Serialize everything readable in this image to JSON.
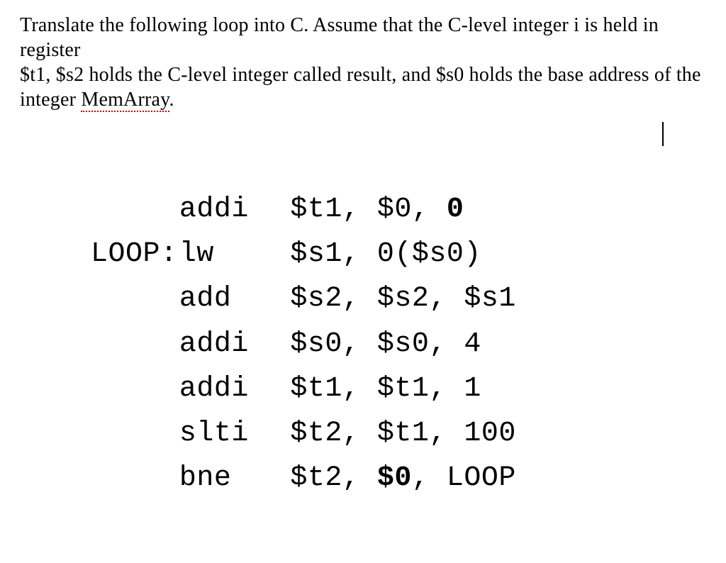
{
  "question": {
    "line1_a": "Translate the following loop into C. Assume that the C-level integer i is held in register",
    "line2_a": "$t1, $s2 holds the C-level integer called result, and $s0 holds the base address of the",
    "line3_a": "integer ",
    "memarray": "MemArray",
    "line3_b": "."
  },
  "code": {
    "l1_label": "",
    "l1_op": "addi",
    "l1_args_a": " $t1, $0, ",
    "l1_args_b": "0",
    "l2_label": "LOOP:",
    "l2_op": "lw",
    "l2_args": " $s1, 0($s0)",
    "l3_label": "",
    "l3_op": "add",
    "l3_args": " $s2, $s2, $s1",
    "l4_label": "",
    "l4_op": "addi",
    "l4_args": " $s0, $s0, 4",
    "l5_label": "",
    "l5_op": "addi",
    "l5_args": " $t1, $t1, 1",
    "l6_label": "",
    "l6_op": "slti",
    "l6_args": " $t2, $t1, 100",
    "l7_label": "",
    "l7_op": "bne",
    "l7_args_a": " $t2, ",
    "l7_args_b": "$0",
    "l7_args_c": ", LOOP"
  }
}
